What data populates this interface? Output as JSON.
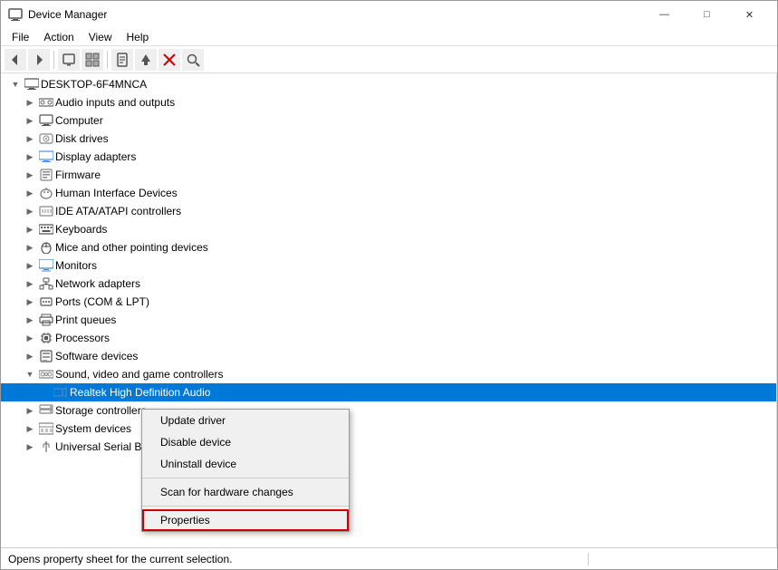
{
  "window": {
    "title": "Device Manager",
    "icon": "🖥",
    "controls": {
      "minimize": "—",
      "maximize": "□",
      "close": "✕"
    }
  },
  "menu": {
    "items": [
      "File",
      "Action",
      "View",
      "Help"
    ]
  },
  "toolbar": {
    "buttons": [
      {
        "name": "back",
        "icon": "◀",
        "label": "Back"
      },
      {
        "name": "forward",
        "icon": "▶",
        "label": "Forward"
      },
      {
        "name": "up",
        "icon": "▪",
        "label": "Up"
      },
      {
        "name": "show-hidden",
        "icon": "▦",
        "label": "Show"
      },
      {
        "name": "properties",
        "icon": "ℹ",
        "label": "Properties"
      },
      {
        "name": "update-driver",
        "icon": "⬆",
        "label": "Update"
      },
      {
        "name": "uninstall",
        "icon": "✕",
        "label": "Uninstall"
      },
      {
        "name": "scan",
        "icon": "🔍",
        "label": "Scan"
      }
    ]
  },
  "tree": {
    "root": {
      "label": "DESKTOP-6F4MNCA",
      "icon": "🖥",
      "expanded": true,
      "children": [
        {
          "label": "Audio inputs and outputs",
          "icon": "🔊",
          "indent": 2
        },
        {
          "label": "Computer",
          "icon": "💻",
          "indent": 2
        },
        {
          "label": "Disk drives",
          "icon": "💾",
          "indent": 2
        },
        {
          "label": "Display adapters",
          "icon": "🖥",
          "indent": 2
        },
        {
          "label": "Firmware",
          "icon": "📋",
          "indent": 2
        },
        {
          "label": "Human Interface Devices",
          "icon": "🖱",
          "indent": 2
        },
        {
          "label": "IDE ATA/ATAPI controllers",
          "icon": "📦",
          "indent": 2
        },
        {
          "label": "Keyboards",
          "icon": "⌨",
          "indent": 2
        },
        {
          "label": "Mice and other pointing devices",
          "icon": "🖱",
          "indent": 2
        },
        {
          "label": "Monitors",
          "icon": "🖥",
          "indent": 2
        },
        {
          "label": "Network adapters",
          "icon": "🌐",
          "indent": 2
        },
        {
          "label": "Ports (COM & LPT)",
          "icon": "🔌",
          "indent": 2
        },
        {
          "label": "Print queues",
          "icon": "🖨",
          "indent": 2
        },
        {
          "label": "Processors",
          "icon": "⚙",
          "indent": 2
        },
        {
          "label": "Software devices",
          "icon": "📦",
          "indent": 2
        },
        {
          "label": "Sound, video and game controllers",
          "icon": "🔊",
          "indent": 2,
          "expanded": true
        },
        {
          "label": "Realtek High Definition Audio",
          "icon": "🔊",
          "indent": 3,
          "highlighted": true
        },
        {
          "label": "Storage controllers",
          "icon": "💾",
          "indent": 2
        },
        {
          "label": "System devices",
          "icon": "⚙",
          "indent": 2
        },
        {
          "label": "Universal Serial Bus controllers",
          "icon": "🔌",
          "indent": 2
        }
      ]
    }
  },
  "context_menu": {
    "items": [
      {
        "label": "Update driver",
        "name": "update-driver-menu"
      },
      {
        "label": "Disable device",
        "name": "disable-device-menu"
      },
      {
        "label": "Uninstall device",
        "name": "uninstall-device-menu"
      },
      {
        "separator": true
      },
      {
        "label": "Scan for hardware changes",
        "name": "scan-hardware-menu"
      },
      {
        "separator": true
      },
      {
        "label": "Properties",
        "name": "properties-menu",
        "highlighted": true
      }
    ]
  },
  "status_bar": {
    "text": "Opens property sheet for the current selection."
  }
}
